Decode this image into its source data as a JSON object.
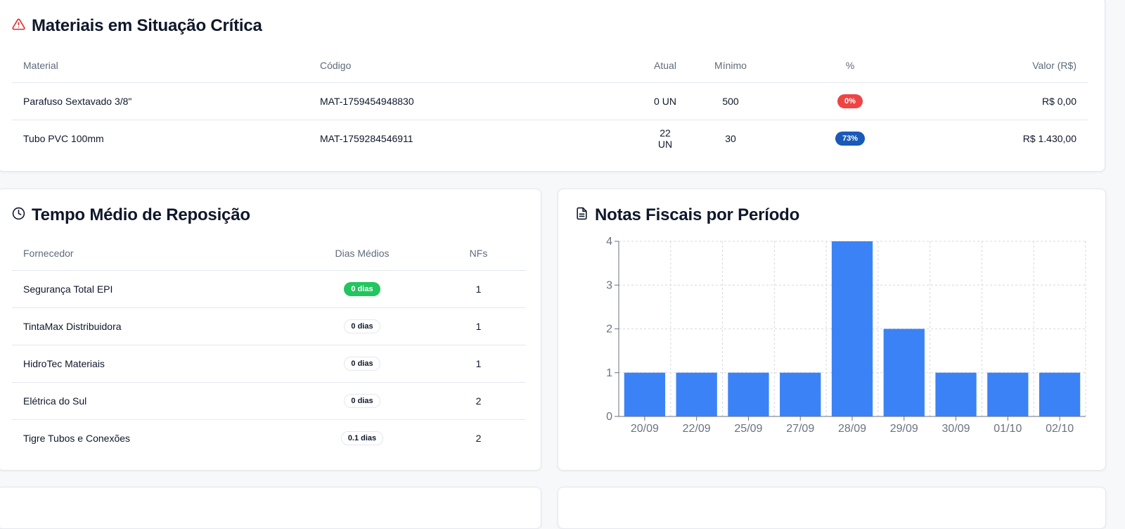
{
  "critical": {
    "title": "Materiais em Situação Crítica",
    "columns": [
      "Material",
      "Código",
      "Atual",
      "Mínimo",
      "%",
      "Valor (R$)"
    ],
    "rows": [
      {
        "material": "Parafuso Sextavado 3/8\"",
        "code": "MAT-1759454948830",
        "current": "0 UN",
        "minimum": "500",
        "pct": "0%",
        "value": "R$ 0,00"
      },
      {
        "material": "Tubo PVC 100mm",
        "code": "MAT-1759284546911",
        "current": "22 UN",
        "minimum": "30",
        "pct": "73%",
        "value": "R$ 1.430,00"
      }
    ]
  },
  "replenishment": {
    "title": "Tempo Médio de Reposição",
    "columns": [
      "Fornecedor",
      "Dias Médios",
      "NFs"
    ],
    "rows": [
      {
        "supplier": "Segurança Total EPI",
        "days": "0 dias",
        "nfs": "1"
      },
      {
        "supplier": "TintaMax Distribuidora",
        "days": "0 dias",
        "nfs": "1"
      },
      {
        "supplier": "HidroTec Materiais",
        "days": "0 dias",
        "nfs": "1"
      },
      {
        "supplier": "Elétrica do Sul",
        "days": "0 dias",
        "nfs": "2"
      },
      {
        "supplier": "Tigre Tubos e Conexões",
        "days": "0.1 dias",
        "nfs": "2"
      }
    ]
  },
  "invoices": {
    "title": "Notas Fiscais por Período"
  },
  "icons": {
    "critical": "alert-triangle-icon",
    "replenishment": "clock-icon",
    "invoices": "file-text-icon"
  },
  "colors": {
    "bar": "#3b82f6",
    "danger": "#ef4444",
    "primary": "#1959b8",
    "success": "#22c55e"
  },
  "chart_data": {
    "type": "bar",
    "categories": [
      "20/09",
      "22/09",
      "25/09",
      "27/09",
      "28/09",
      "29/09",
      "30/09",
      "01/10",
      "02/10"
    ],
    "values": [
      1,
      1,
      1,
      1,
      4,
      2,
      1,
      1,
      1
    ],
    "yticks": [
      0,
      1,
      2,
      3,
      4
    ],
    "ylim": [
      0,
      4
    ],
    "grid": true
  }
}
